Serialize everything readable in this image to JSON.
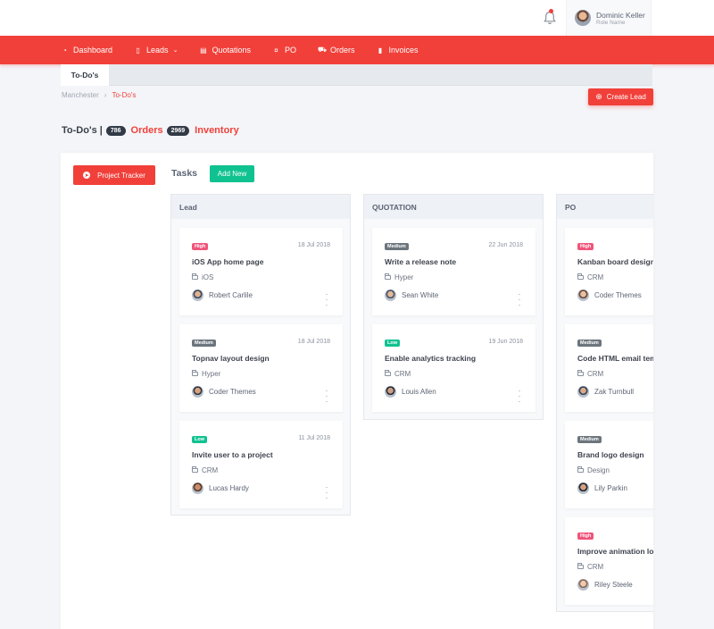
{
  "header": {
    "bell_icon": "bell-icon",
    "user": {
      "name": "Dominic Keller",
      "role": "Role Name"
    }
  },
  "nav": [
    {
      "label": "Dashboard",
      "icon": "dashboard-icon",
      "glyph": "◔"
    },
    {
      "label": "Leads",
      "icon": "file-icon",
      "glyph": "▯",
      "caret": "⌄"
    },
    {
      "label": "Quotations",
      "icon": "document-icon",
      "glyph": "▤"
    },
    {
      "label": "PO",
      "icon": "po-icon",
      "glyph": "¤"
    },
    {
      "label": "Orders",
      "icon": "cart-icon",
      "glyph": "⛟"
    },
    {
      "label": "Invoices",
      "icon": "invoice-icon",
      "glyph": "▮"
    }
  ],
  "tab": {
    "label": "To-Do's"
  },
  "breadcrumb": {
    "root": "Manchester",
    "sep": "›",
    "current": "To-Do's"
  },
  "create_lead": {
    "label": "Create Lead",
    "glyph": "⊕"
  },
  "page_head": {
    "title": "To-Do's |",
    "todo_count": "786",
    "orders_label": "Orders",
    "orders_count": "2969",
    "inventory_label": "Inventory"
  },
  "board": {
    "tracker_label": "Project Tracker",
    "tasks_label": "Tasks",
    "add_new_label": "Add New"
  },
  "colors": {
    "accent": "#f1403a",
    "success": "#10c290",
    "high": "#f0547a",
    "medium": "#6c757d",
    "low": "#10c290",
    "dark": "#313a46"
  },
  "columns": [
    {
      "title": "Lead",
      "tasks": [
        {
          "priority": "High",
          "date": "18 Jul 2018",
          "title": "iOS App home page",
          "project": "iOS",
          "user": "Robert Carlile"
        },
        {
          "priority": "Medium",
          "date": "18 Jul 2018",
          "title": "Topnav layout design",
          "project": "Hyper",
          "user": "Coder Themes"
        },
        {
          "priority": "Low",
          "date": "11 Jul 2018",
          "title": "Invite user to a project",
          "project": "CRM",
          "user": "Lucas Hardy"
        }
      ]
    },
    {
      "title": "QUOTATION",
      "tasks": [
        {
          "priority": "Medium",
          "date": "22 Jun 2018",
          "title": "Write a release note",
          "project": "Hyper",
          "user": "Sean White"
        },
        {
          "priority": "Low",
          "date": "19 Jun 2018",
          "title": "Enable analytics tracking",
          "project": "CRM",
          "user": "Louis Allen"
        }
      ]
    },
    {
      "title": "PO",
      "tasks": [
        {
          "priority": "High",
          "date": "",
          "title": "Kanban board design",
          "project": "CRM",
          "user": "Coder Themes"
        },
        {
          "priority": "Medium",
          "date": "",
          "title": "Code HTML email template",
          "project": "CRM",
          "user": "Zak Turnbull"
        },
        {
          "priority": "Medium",
          "date": "",
          "title": "Brand logo design",
          "project": "Design",
          "user": "Lily Parkin"
        },
        {
          "priority": "High",
          "date": "",
          "title": "Improve animation loader",
          "project": "CRM",
          "user": "Riley Steele"
        }
      ]
    }
  ]
}
